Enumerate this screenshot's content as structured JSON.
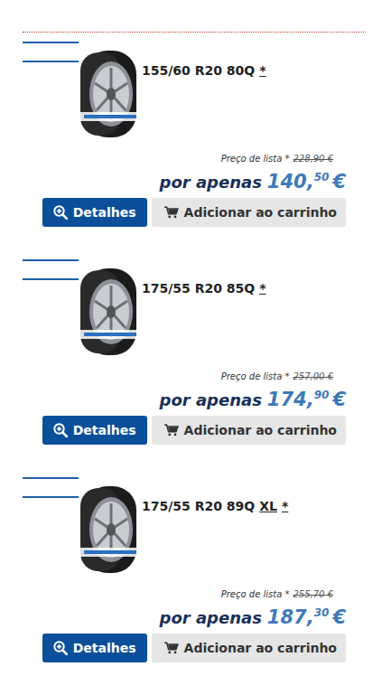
{
  "products": [
    {
      "size": "155/60 R20 80Q",
      "marks": [
        "*"
      ],
      "list_label": "Preço de lista *",
      "list_price": "228,90 €",
      "offer_label": "por apenas",
      "price_main": "140,",
      "price_cents": "50",
      "currency": "€",
      "details_button": "Detalhes",
      "cart_button": "Adicionar ao carrinho"
    },
    {
      "size": "175/55 R20 85Q",
      "marks": [
        "*"
      ],
      "list_label": "Preço de lista *",
      "list_price": "257,00 €",
      "offer_label": "por apenas",
      "price_main": "174,",
      "price_cents": "90",
      "currency": "€",
      "details_button": "Detalhes",
      "cart_button": "Adicionar ao carrinho"
    },
    {
      "size": "175/55 R20 89Q",
      "marks": [
        "XL",
        "*"
      ],
      "list_label": "Preço de lista *",
      "list_price": "255,70 €",
      "offer_label": "por apenas",
      "price_main": "187,",
      "price_cents": "30",
      "currency": "€",
      "details_button": "Detalhes",
      "cart_button": "Adicionar ao carrinho"
    }
  ]
}
